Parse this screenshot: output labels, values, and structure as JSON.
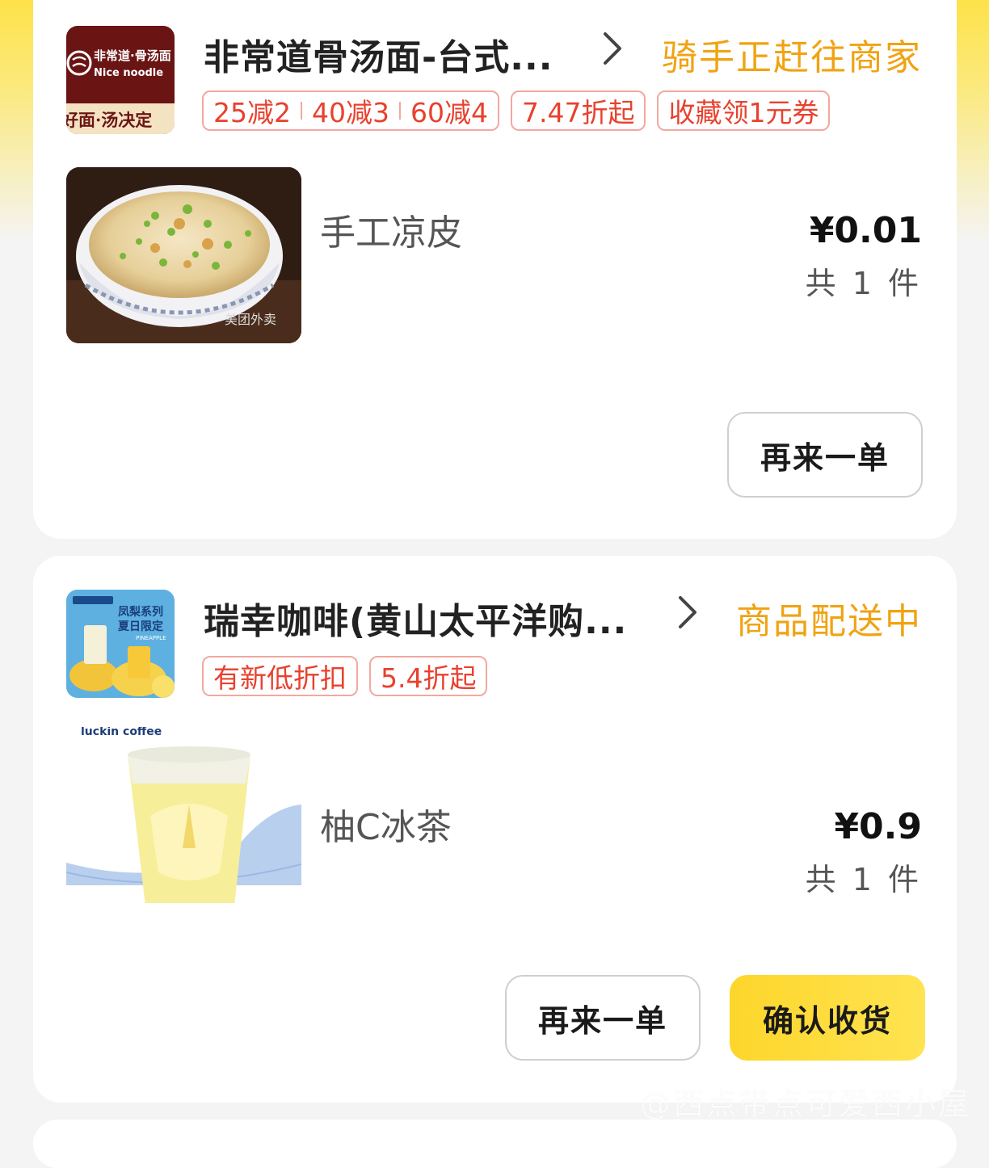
{
  "orders": [
    {
      "store_name": "非常道骨汤面-台式...",
      "status": "骑手正赶往商家",
      "logo_text_1": "非常道·骨汤面",
      "logo_text_2": "Nice noodle",
      "logo_text_3": "好面·汤决定",
      "tags": [
        {
          "parts": [
            "25减2",
            "40减3",
            "60减4"
          ]
        },
        {
          "parts": [
            "7.47折起"
          ]
        },
        {
          "parts": [
            "收藏领1元券"
          ]
        }
      ],
      "item": {
        "name": "手工凉皮",
        "price": "¥0.01",
        "quantity": "共 1 件",
        "image_watermark": "美团外卖"
      },
      "buttons": {
        "reorder": "再来一单"
      }
    },
    {
      "store_name": "瑞幸咖啡(黄山太平洋购...",
      "status": "商品配送中",
      "logo_text_1": "凤梨系列",
      "logo_text_2": "夏日限定",
      "logo_text_3": "PINEAPPLE",
      "tags": [
        {
          "parts": [
            "有新低折扣"
          ]
        },
        {
          "parts": [
            "5.4折起"
          ]
        }
      ],
      "item": {
        "name": "柚C冰茶",
        "price": "¥0.9",
        "quantity": "共 1 件",
        "image_watermark": "luckin coffee"
      },
      "buttons": {
        "reorder": "再来一单",
        "confirm": "确认收货"
      }
    }
  ],
  "watermark": "@西点带点可爱西小屋",
  "colors": {
    "status": "#f0a312",
    "tag": "#e8412e",
    "primary_button": "#fdd62b"
  }
}
